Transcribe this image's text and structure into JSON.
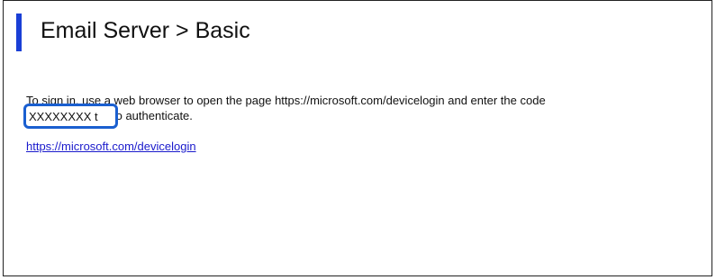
{
  "header": {
    "title": "Email Server > Basic"
  },
  "content": {
    "instruction_line1": "To sign in, use a web browser to open the page https://microsoft.com/devicelogin and enter the code",
    "code": "XXXXXXXX",
    "instruction_line2_suffix": " to authenticate.",
    "link_text": "https://microsoft.com/devicelogin"
  },
  "colors": {
    "accent_bar": "#1a3fd6",
    "highlight_border": "#1a5fd0",
    "link": "#1a1acc"
  }
}
